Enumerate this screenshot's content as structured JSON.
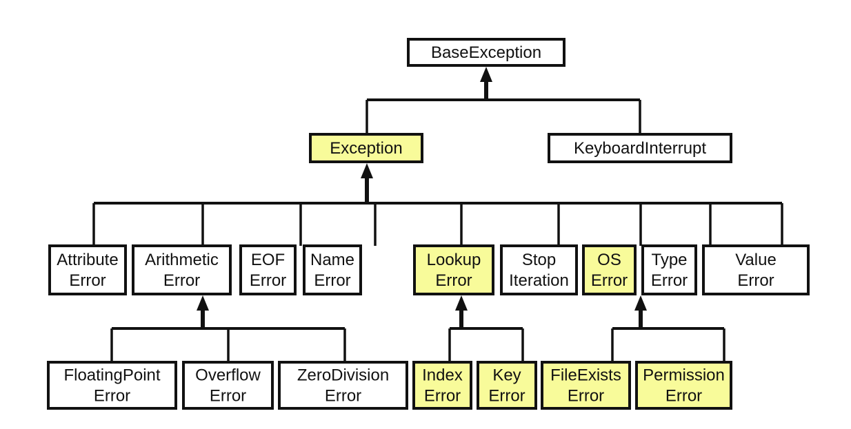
{
  "colors": {
    "highlight": "#f8fb9a",
    "normal": "#ffffff",
    "stroke": "#111111"
  },
  "nodes": {
    "base": {
      "lines": [
        "BaseException"
      ],
      "highlighted": false
    },
    "exception": {
      "lines": [
        "Exception"
      ],
      "highlighted": true
    },
    "keyboard": {
      "lines": [
        "KeyboardInterrupt"
      ],
      "highlighted": false
    },
    "attribute": {
      "lines": [
        "Attribute",
        "Error"
      ],
      "highlighted": false
    },
    "arithmetic": {
      "lines": [
        "Arithmetic",
        "Error"
      ],
      "highlighted": false
    },
    "eof": {
      "lines": [
        "EOF",
        "Error"
      ],
      "highlighted": false
    },
    "name": {
      "lines": [
        "Name",
        "Error"
      ],
      "highlighted": false
    },
    "lookup": {
      "lines": [
        "Lookup",
        "Error"
      ],
      "highlighted": true
    },
    "stop": {
      "lines": [
        "Stop",
        "Iteration"
      ],
      "highlighted": false
    },
    "os": {
      "lines": [
        "OS",
        "Error"
      ],
      "highlighted": true
    },
    "type": {
      "lines": [
        "Type",
        "Error"
      ],
      "highlighted": false
    },
    "value": {
      "lines": [
        "Value",
        "Error"
      ],
      "highlighted": false
    },
    "floating": {
      "lines": [
        "FloatingPoint",
        "Error"
      ],
      "highlighted": false
    },
    "overflow": {
      "lines": [
        "Overflow",
        "Error"
      ],
      "highlighted": false
    },
    "zerodiv": {
      "lines": [
        "ZeroDivision",
        "Error"
      ],
      "highlighted": false
    },
    "index": {
      "lines": [
        "Index",
        "Error"
      ],
      "highlighted": true
    },
    "key": {
      "lines": [
        "Key",
        "Error"
      ],
      "highlighted": true
    },
    "fileexists": {
      "lines": [
        "FileExists",
        "Error"
      ],
      "highlighted": true
    },
    "permission": {
      "lines": [
        "Permission",
        "Error"
      ],
      "highlighted": true
    }
  },
  "edges": [
    {
      "parent": "base",
      "children": [
        "exception",
        "keyboard"
      ]
    },
    {
      "parent": "exception",
      "children": [
        "attribute",
        "arithmetic",
        "eof",
        "name",
        "lookup",
        "stop",
        "os",
        "type",
        "value"
      ]
    },
    {
      "parent": "arithmetic",
      "children": [
        "floating",
        "overflow",
        "zerodiv"
      ]
    },
    {
      "parent": "lookup",
      "children": [
        "index",
        "key"
      ]
    },
    {
      "parent": "os",
      "children": [
        "fileexists",
        "permission"
      ]
    }
  ]
}
